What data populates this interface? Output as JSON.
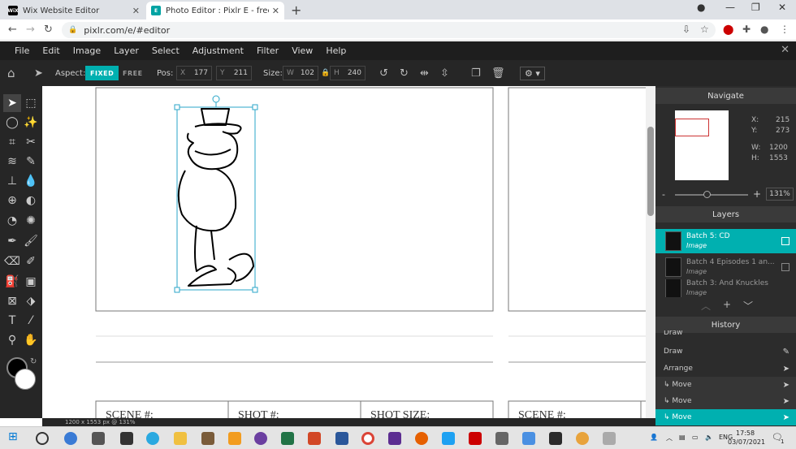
{
  "browser": {
    "tabs": [
      {
        "label": "Wix Website Editor",
        "favicon": "WiX",
        "active": false
      },
      {
        "label": "Photo Editor : Pixlr E - free image",
        "favicon": "E",
        "active": true
      }
    ],
    "url": "pixlr.com/e/#editor"
  },
  "menu": [
    "File",
    "Edit",
    "Image",
    "Layer",
    "Select",
    "Adjustment",
    "Filter",
    "View",
    "Help"
  ],
  "options": {
    "aspect_label": "Aspect:",
    "fixed": "FIXED",
    "free": "FREE",
    "pos_label": "Pos:",
    "x_label": "X",
    "x_value": "177",
    "y_label": "Y",
    "y_value": "211",
    "size_label": "Size:",
    "w_label": "W",
    "w_value": "102",
    "h_label": "H",
    "h_value": "240"
  },
  "navigate": {
    "title": "Navigate",
    "x_label": "X:",
    "x": "215",
    "y_label": "Y:",
    "y": "273",
    "w_label": "W:",
    "w": "1200",
    "h_label": "H:",
    "h": "1553",
    "zoom": "131%",
    "minus": "-",
    "plus": "+"
  },
  "layers": {
    "title": "Layers",
    "items": [
      {
        "name": "Batch 5: CD",
        "type": "Image",
        "selected": true
      },
      {
        "name": "Batch 4 Episodes 1 an...",
        "type": "Image",
        "selected": false
      },
      {
        "name": "Batch 3: And Knuckles",
        "type": "Image",
        "selected": false
      }
    ]
  },
  "history": {
    "title": "History",
    "partial_top": "Draw",
    "items": [
      {
        "label": "Draw",
        "selected": false
      },
      {
        "label": "Arrange",
        "selected": false
      },
      {
        "label": "↳ Move",
        "selected": false
      },
      {
        "label": "↳ Move",
        "selected": false
      },
      {
        "label": "↳ Move",
        "selected": true
      }
    ]
  },
  "storyboard": {
    "scene": "SCENE #:",
    "shot": "SHOT #:",
    "shot_size": "SHOT SIZE:",
    "scene2": "SCENE #:"
  },
  "status": "1200 x 1553 px @ 131%",
  "taskbar": {
    "lang": "ENG",
    "time": "17:58",
    "date": "03/07/2021",
    "notif": "1"
  },
  "colors": {
    "accent": "#00b0b0",
    "panel": "#2c2c2c",
    "toolbar": "#262626"
  }
}
